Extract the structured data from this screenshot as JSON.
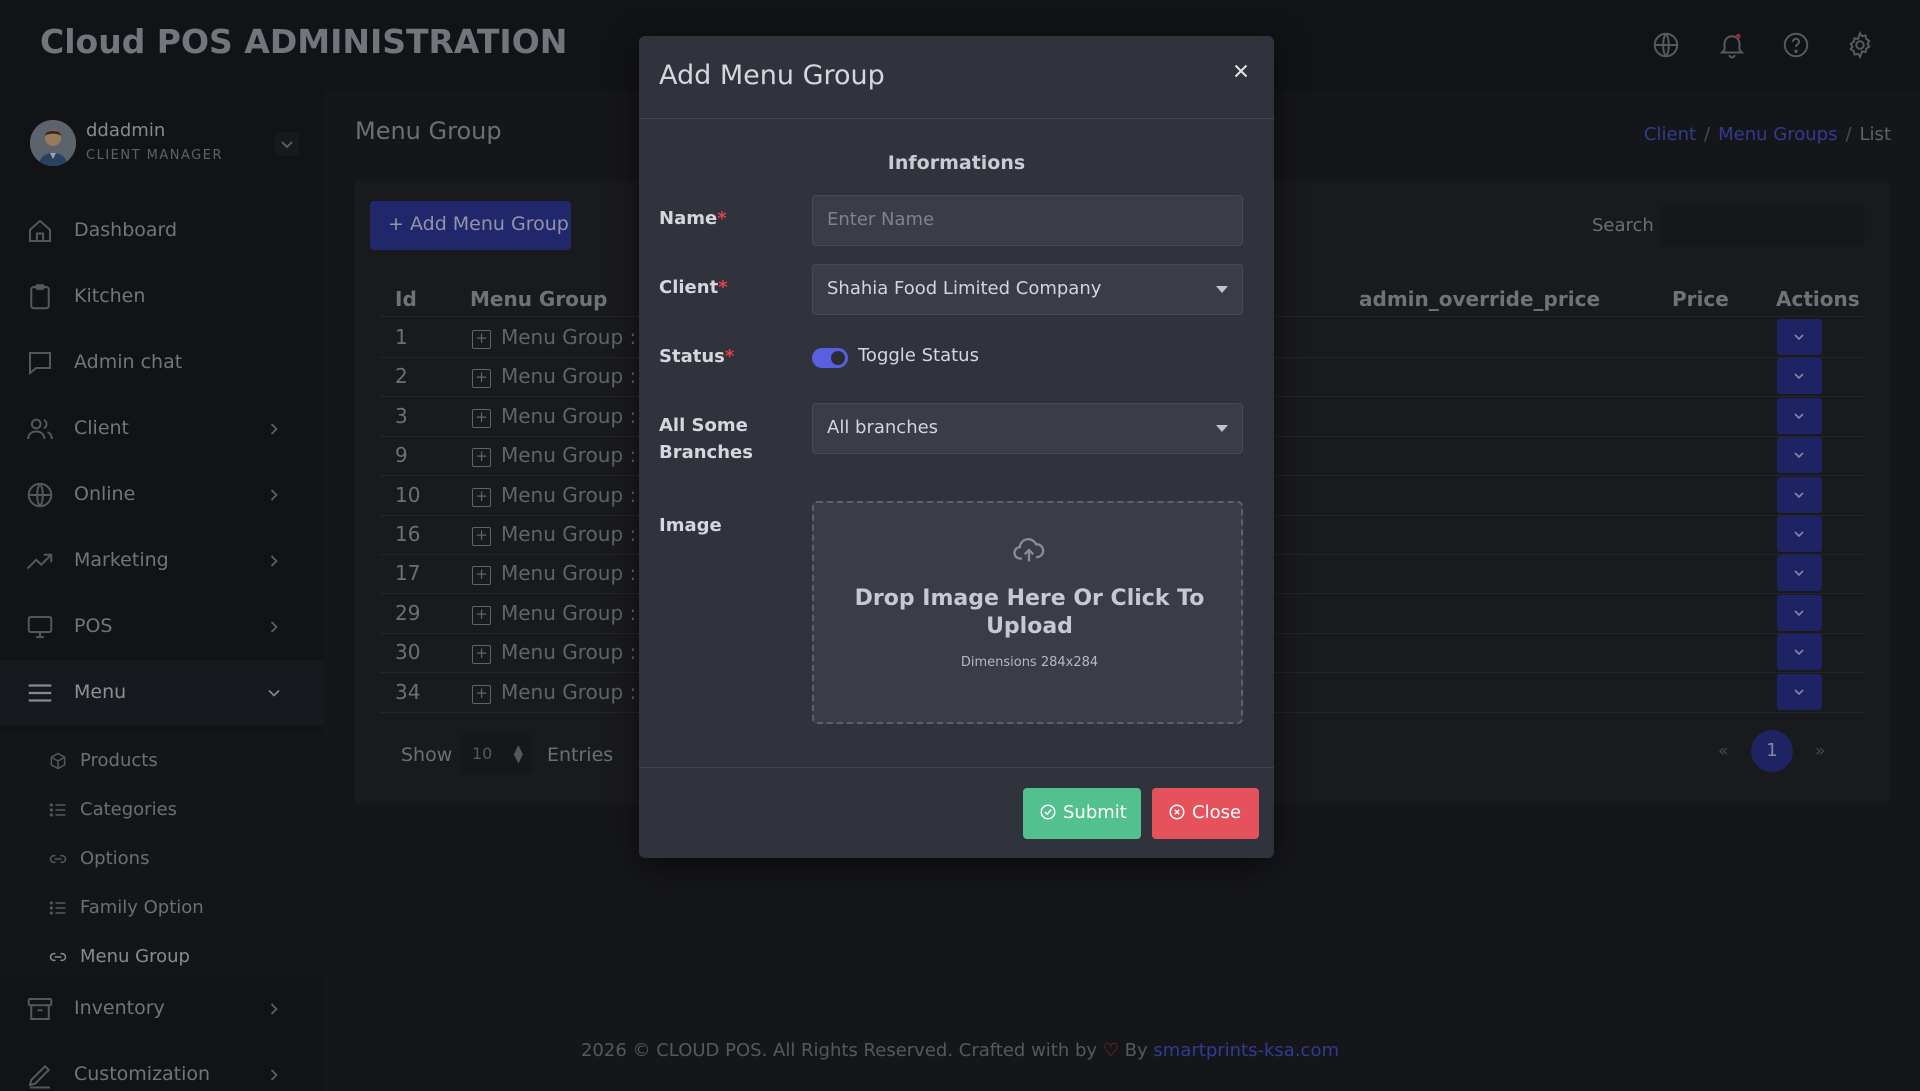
{
  "app": {
    "title": "Cloud POS ADMINISTRATION"
  },
  "header_icons": [
    "globe-icon",
    "bell-icon",
    "help-icon",
    "gear-icon"
  ],
  "user": {
    "name": "ddadmin",
    "role": "CLIENT MANAGER"
  },
  "sidebar": {
    "items": [
      {
        "label": "Dashboard",
        "icon": "home-icon"
      },
      {
        "label": "Kitchen",
        "icon": "clipboard-icon"
      },
      {
        "label": "Admin chat",
        "icon": "chat-icon"
      },
      {
        "label": "Client",
        "icon": "users-icon"
      },
      {
        "label": "Online",
        "icon": "globe-icon"
      },
      {
        "label": "Marketing",
        "icon": "trending-icon"
      },
      {
        "label": "POS",
        "icon": "monitor-icon"
      },
      {
        "label": "Menu",
        "icon": "menu-icon"
      },
      {
        "label": "Inventory",
        "icon": "archive-icon"
      },
      {
        "label": "Customization",
        "icon": "pen-icon"
      }
    ],
    "submenu": [
      {
        "label": "Products",
        "icon": "cube-icon"
      },
      {
        "label": "Categories",
        "icon": "list-icon"
      },
      {
        "label": "Options",
        "icon": "link-icon"
      },
      {
        "label": "Family Option",
        "icon": "list-icon"
      },
      {
        "label": "Menu Group",
        "icon": "link-icon"
      }
    ]
  },
  "page": {
    "title": "Menu Group",
    "breadcrumb": [
      "Client",
      "Menu Groups",
      "List"
    ],
    "add_button": "Add Menu Group",
    "search_label": "Search",
    "table": {
      "headers": [
        "Id",
        "Menu Group",
        "admin_override_price",
        "Price",
        "Actions"
      ],
      "rows": [
        {
          "id": "1",
          "group": "Menu Group : K"
        },
        {
          "id": "2",
          "group": "Menu Group : T"
        },
        {
          "id": "3",
          "group": "Menu Group : B"
        },
        {
          "id": "9",
          "group": "Menu Group : d"
        },
        {
          "id": "10",
          "group": "Menu Group : t"
        },
        {
          "id": "16",
          "group": "Menu Group : d"
        },
        {
          "id": "17",
          "group": "Menu Group : t"
        },
        {
          "id": "29",
          "group": "Menu Group : t"
        },
        {
          "id": "30",
          "group": "Menu Group : A"
        },
        {
          "id": "34",
          "group": "Menu Group : s"
        }
      ]
    },
    "show_label": "Show",
    "show_value": "10",
    "entries_label": "Entries",
    "pagination": {
      "prev": "«",
      "current": "1",
      "next": "»"
    }
  },
  "footer": {
    "text": "2026 © CLOUD POS. All Rights Reserved. Crafted with by",
    "by": "By",
    "link": "smartprints-ksa.com"
  },
  "modal": {
    "title": "Add Menu Group",
    "section": "Informations",
    "name_label": "Name",
    "name_placeholder": "Enter Name",
    "client_label": "Client",
    "client_value": "Shahia Food Limited Company",
    "status_label": "Status",
    "status_toggle": "Toggle Status",
    "status_on": true,
    "branches_label": "All Some Branches",
    "branches_value": "All branches",
    "image_label": "Image",
    "dropzone_text": "Drop Image Here Or Click To Upload",
    "dropzone_hint": "Dimensions 284x284",
    "submit": "Submit",
    "close": "Close"
  },
  "colors": {
    "accent": "#2d3494",
    "link": "#4a58d6",
    "submit": "#52c08f",
    "close": "#e5525c",
    "required": "#e0414b"
  }
}
